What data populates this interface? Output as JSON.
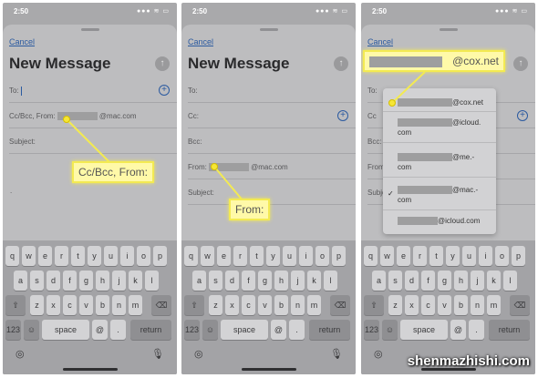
{
  "status": {
    "time": "2:50",
    "icons": "●●● ≋ ▭"
  },
  "sheet": {
    "cancel": "Cancel",
    "title": "New Message",
    "send_icon": "arrow-up-icon"
  },
  "fields": {
    "to": "To:",
    "cc_bcc_from": "Cc/Bcc, From:",
    "cc": "Cc:",
    "bcc": "Bcc:",
    "from": "From:",
    "subject": "Subject:",
    "subject_short": "Subje",
    "from_short": "From",
    "cc_short": "Cc",
    "to_short": "To:"
  },
  "values": {
    "mac": "@mac.com",
    "cox": "@cox.net"
  },
  "callouts": {
    "p1": "Cc/Bcc, From:",
    "p2": "From:",
    "p3": "@cox.net"
  },
  "menu": [
    {
      "line1": "@cox.net",
      "line2": ""
    },
    {
      "line1": "@icloud.",
      "line2": "com"
    },
    {
      "line1": "@me.-",
      "line2": "com"
    },
    {
      "line1": "@mac.-",
      "line2": "com",
      "checked": true
    },
    {
      "line1": "@icloud.com",
      "line2": ""
    }
  ],
  "keyboard": {
    "row1": [
      "q",
      "w",
      "e",
      "r",
      "t",
      "y",
      "u",
      "i",
      "o",
      "p"
    ],
    "row2": [
      "a",
      "s",
      "d",
      "f",
      "g",
      "h",
      "j",
      "k",
      "l"
    ],
    "row3": [
      "z",
      "x",
      "c",
      "v",
      "b",
      "n",
      "m"
    ],
    "shift": "⇧",
    "backspace": "⌫",
    "num": "123",
    "emoji": "☺",
    "space": "space",
    "at": "@",
    "dot": ".",
    "return": "return",
    "globe": "◎",
    "mic": "🎙"
  },
  "watermark": "shenmazhishi.com",
  "colors": {
    "accent": "#2b5aa0",
    "callout": "#fff9a8",
    "callout_border": "#f3ea52"
  }
}
